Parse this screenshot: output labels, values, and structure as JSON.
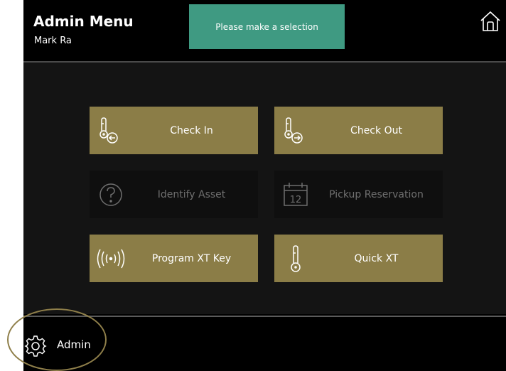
{
  "header": {
    "title": "Admin Menu",
    "user": "Mark Ra",
    "banner": "Please make a selection"
  },
  "tiles": [
    {
      "label": "Check In",
      "icon": "key-return-icon",
      "enabled": true
    },
    {
      "label": "Check Out",
      "icon": "key-checkout-icon",
      "enabled": true
    },
    {
      "label": "Identify Asset",
      "icon": "question-circle-icon",
      "enabled": false
    },
    {
      "label": "Pickup Reservation",
      "icon": "calendar-icon",
      "calendar_day": "12",
      "enabled": false
    },
    {
      "label": "Program XT Key",
      "icon": "wireless-signal-icon",
      "enabled": true
    },
    {
      "label": "Quick XT",
      "icon": "key-icon",
      "enabled": true
    }
  ],
  "footer": {
    "admin_label": "Admin",
    "admin_icon": "gear-icon"
  },
  "colors": {
    "background": "#000000",
    "panel": "#141414",
    "tile": "#8b7d47",
    "tile_disabled": "#0f0f0f",
    "banner": "#3f9a82",
    "highlight": "#8f7f4a"
  }
}
